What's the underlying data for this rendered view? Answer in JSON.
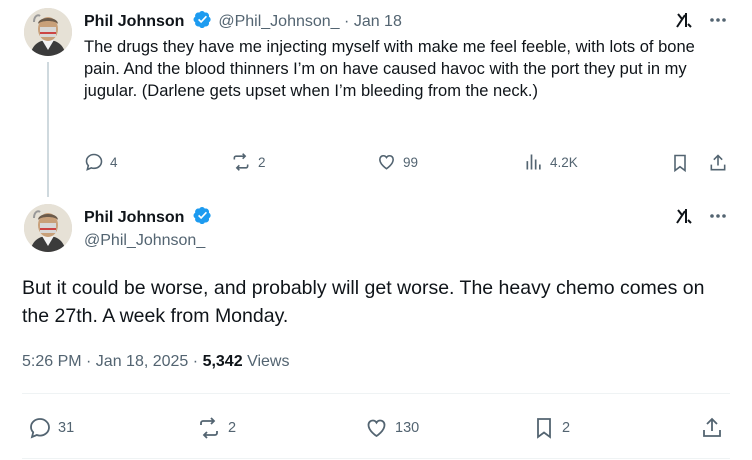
{
  "tweet1": {
    "display_name": "Phil Johnson",
    "handle": "@Phil_Johnson_",
    "date": "Jan 18",
    "separator": "·",
    "text": "The drugs they have me injecting myself with make me feel feeble, with lots of bone pain. And the blood thinners I’m on have caused havoc with the port they put in my jugular. (Darlene gets upset when I’m bleeding from the neck.)",
    "actions": {
      "replies": "4",
      "reposts": "2",
      "likes": "99",
      "views": "4.2K"
    }
  },
  "tweet2": {
    "display_name": "Phil Johnson",
    "handle": "@Phil_Johnson_",
    "text": "But it could be worse, and probably will get worse. The heavy chemo comes on the 27th. A week from Monday.",
    "time": "5:26 PM · Jan 18, 2025 ·",
    "views_count": "5,342",
    "views_label": "Views",
    "actions": {
      "replies": "31",
      "reposts": "2",
      "likes": "130",
      "bookmarks": "2"
    }
  },
  "colors": {
    "verified": "#1d9bf0",
    "muted": "#536471",
    "text": "#0f1419",
    "line": "#cfd9de"
  },
  "icons": [
    "verified-badge-icon",
    "grok-icon",
    "more-icon",
    "reply-icon",
    "repost-icon",
    "like-icon",
    "views-icon",
    "bookmark-icon",
    "share-icon"
  ]
}
